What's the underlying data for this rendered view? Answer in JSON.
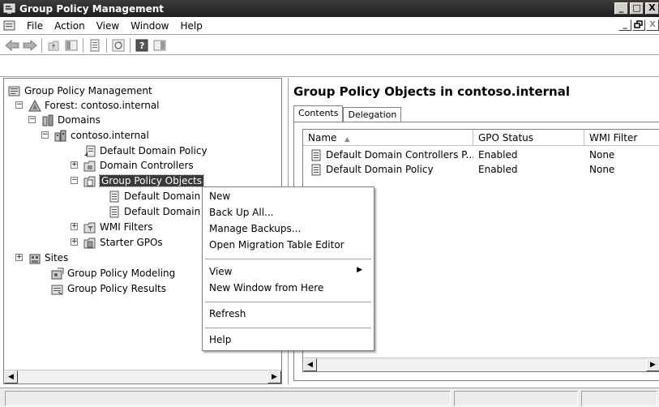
{
  "window": {
    "title": "Group Policy Management",
    "controls": {
      "minimize": "_",
      "maximize": "□",
      "close": "X"
    }
  },
  "menubar": {
    "items": [
      "File",
      "Action",
      "View",
      "Window",
      "Help"
    ],
    "mdi_controls": {
      "minimize": "_",
      "restore": "🗗",
      "close": "X"
    }
  },
  "toolbar": {
    "buttons": [
      "back-arrow",
      "forward-arrow",
      "up-folder",
      "show-hide-tree",
      "properties",
      "refresh",
      "help",
      "show-action-pane"
    ]
  },
  "tree": {
    "nodes": [
      {
        "label": "Group Policy Management",
        "icon": "gpm-console-icon"
      },
      {
        "label": "Forest: contoso.internal",
        "icon": "forest-icon",
        "expander": "−"
      },
      {
        "label": "Domains",
        "icon": "domains-icon",
        "expander": "−"
      },
      {
        "label": "contoso.internal",
        "icon": "domain-icon",
        "expander": "−"
      },
      {
        "label": "Default Domain Policy",
        "icon": "gpo-link-icon"
      },
      {
        "label": "Domain Controllers",
        "icon": "ou-icon",
        "expander": "+"
      },
      {
        "label": "Group Policy Objects",
        "icon": "gpo-folder-icon",
        "expander": "−",
        "selected": true
      },
      {
        "label": "Default Domain Controllers Policy",
        "icon": "gpo-icon"
      },
      {
        "label": "Default Domain Policy",
        "icon": "gpo-icon"
      },
      {
        "label": "WMI Filters",
        "icon": "wmi-filter-icon",
        "expander": "+"
      },
      {
        "label": "Starter GPOs",
        "icon": "starter-gpo-icon",
        "expander": "+"
      },
      {
        "label": "Sites",
        "icon": "sites-icon",
        "expander": "+"
      },
      {
        "label": "Group Policy Modeling",
        "icon": "modeling-icon"
      },
      {
        "label": "Group Policy Results",
        "icon": "results-icon"
      }
    ]
  },
  "right_pane": {
    "title": "Group Policy Objects in contoso.internal",
    "tabs": [
      "Contents",
      "Delegation"
    ],
    "columns": [
      "Name",
      "GPO Status",
      "WMI Filter"
    ],
    "sort_indicator": "▲",
    "rows": [
      {
        "name": "Default Domain Controllers P...",
        "status": "Enabled",
        "wmi": "None"
      },
      {
        "name": "Default Domain Policy",
        "status": "Enabled",
        "wmi": "None"
      }
    ]
  },
  "context_menu": {
    "items": [
      "New",
      "Back Up All...",
      "Manage Backups...",
      "Open Migration Table Editor",
      "View",
      "New Window from Here",
      "Refresh",
      "Help"
    ],
    "submenu_arrow": "▶"
  },
  "scrollbar": {
    "left_arrow": "◀",
    "right_arrow": "▶"
  }
}
